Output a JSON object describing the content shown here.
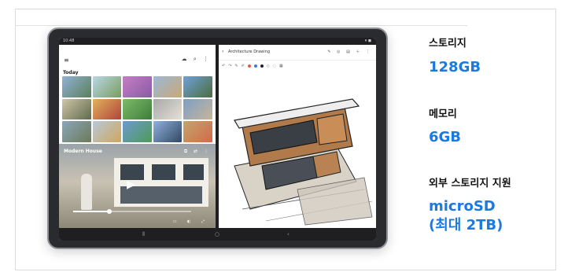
{
  "specs": [
    {
      "label": "스토리지",
      "value": "128GB"
    },
    {
      "label": "메모리",
      "value": "6GB"
    },
    {
      "label": "외부 스토리지 지원",
      "value_line1": "microSD",
      "value_line2": "(최대 2TB)"
    }
  ],
  "colors": {
    "accent": "#1a7ae0",
    "label": "#111111",
    "tablet_frame": "#2a2b2e"
  },
  "tablet": {
    "gallery": {
      "section_title": "Today",
      "video_title": "Modern House"
    },
    "drawing": {
      "document_title": "Architecture Drawing"
    },
    "icons": [
      "menu-icon",
      "cloud-icon",
      "search-icon",
      "more-icon",
      "play-icon",
      "back-icon",
      "undo-icon",
      "redo-icon"
    ]
  }
}
